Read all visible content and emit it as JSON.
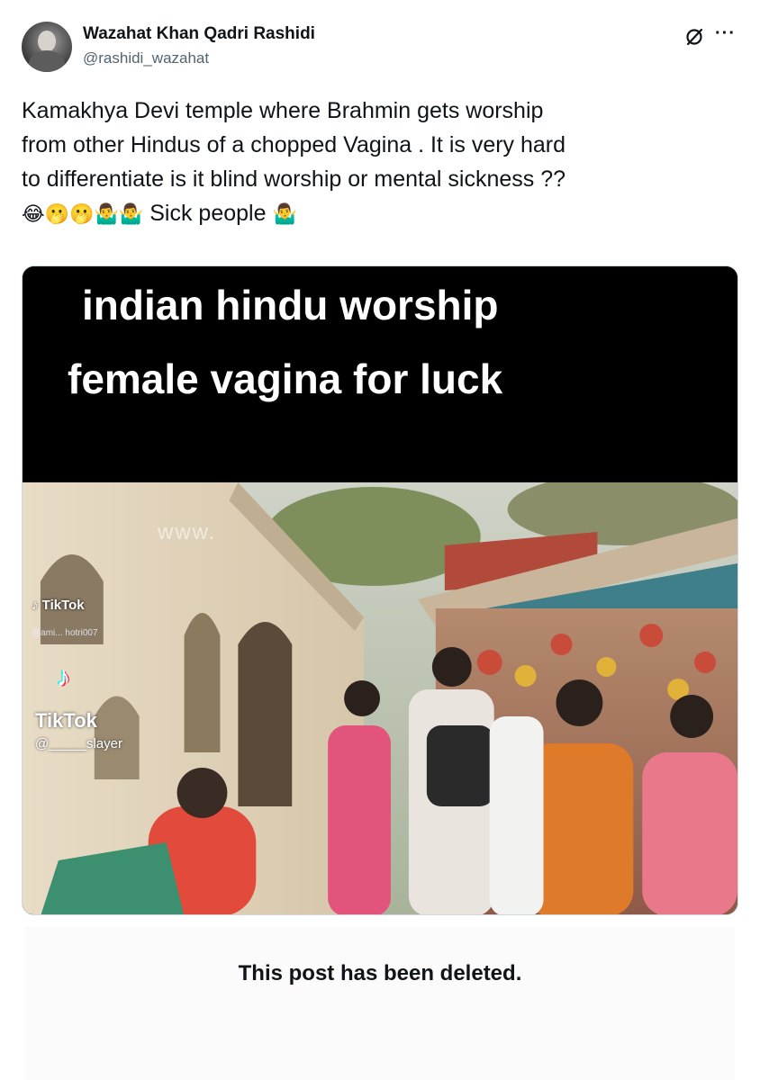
{
  "post": {
    "author_name": "Wazahat Khan Qadri Rashidi",
    "author_handle": "@rashidi_wazahat",
    "header_icons": [
      "grok-icon",
      "more-icon"
    ],
    "more_label": "···",
    "text_lines": [
      "Kamakhya Devi temple where Brahmin gets worship",
      "from other Hindus of a chopped Vagina .  It is very hard",
      "to differentiate is it blind worship or mental sickness ??"
    ],
    "emoji_line": "😂🫢🫢🤷‍♂️🤷‍♂️",
    "trailing_text": "Sick people",
    "trailing_emoji": "🤷‍♂️"
  },
  "media": {
    "caption_line1": "indian hindu worship",
    "caption_line2": "female vagina for luck",
    "watermark": "www.",
    "tiktok_label_1": "TikTok",
    "tiktok_user_1": "@ami... hotri007",
    "tiktok_label_2": "TikTok",
    "tiktok_user_2": "@_____slayer"
  },
  "deleted_notice": "This post has been deleted."
}
